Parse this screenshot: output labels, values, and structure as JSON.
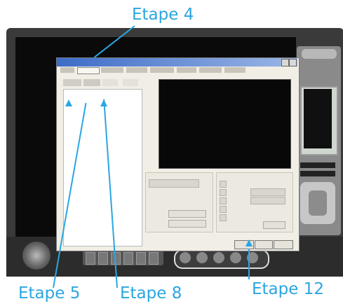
{
  "annotations": {
    "etape4": "Etape 4",
    "etape5": "Etape 5",
    "etape8": "Etape 8",
    "etape12": "Etape 12"
  },
  "colors": {
    "annotation": "#2aa6e2",
    "shell": "#3a3a3a",
    "dialog": "#f1eee6",
    "titlebar": "#3d6cc7",
    "preview": "#080808"
  },
  "icons": {
    "record": "circle-button-icon",
    "toolbar": [
      "tool-icon-1",
      "tool-icon-2",
      "tool-icon-3",
      "tool-icon-4",
      "tool-icon-5",
      "tool-icon-6"
    ],
    "playback": [
      "play-icon",
      "pause-icon",
      "stop-icon",
      "record-icon",
      "skip-icon"
    ]
  }
}
